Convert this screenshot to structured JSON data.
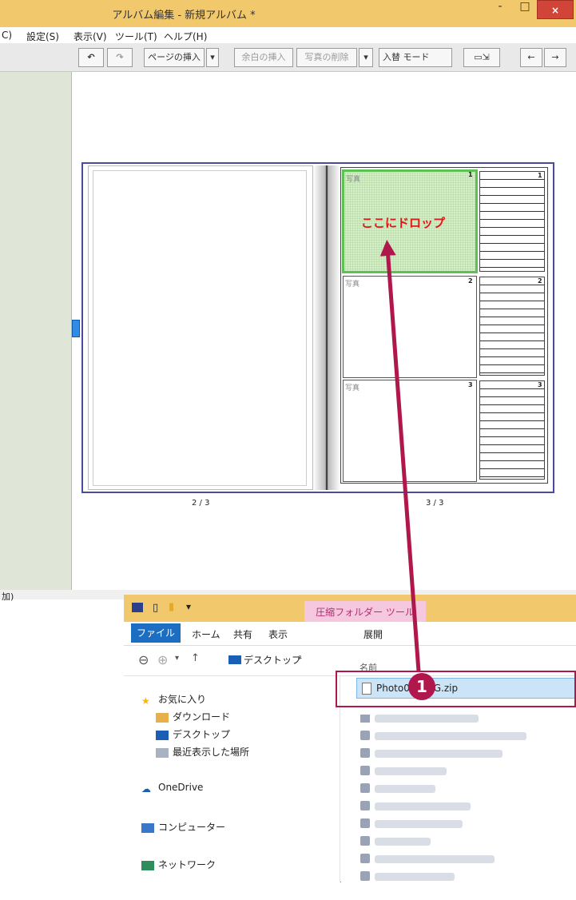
{
  "window": {
    "title": "アルバム編集 - 新規アルバム *",
    "close_label": "×",
    "minimize_label": "-",
    "maximize_label": "□"
  },
  "menu": [
    "C)",
    "設定(S)",
    "表示(V)",
    "ツール(T)",
    "ヘルプ(H)"
  ],
  "toolbar": {
    "insert_page": "ページの挿入",
    "insert_margin": "余白の挿入",
    "delete_photo": "写真の削除",
    "replace_mode": "入替 モード",
    "left_arrow": "←",
    "right_arrow": "→"
  },
  "page": {
    "left_number": "2 / 3",
    "right_number": "3 / 3",
    "cells": [
      {
        "label": "写真",
        "num": "1"
      },
      {
        "label": "写真",
        "num": "2"
      },
      {
        "label": "写真",
        "num": "3"
      }
    ],
    "drop_hint": "ここにドロップ"
  },
  "status": {
    "left": "加)"
  },
  "explorer": {
    "context_tool": "圧縮フォルダー ツール",
    "tabs": {
      "file": "ファイル",
      "home": "ホーム",
      "share": "共有",
      "view": "表示",
      "extract": "展開"
    },
    "address": "デスクトップ",
    "column_name": "名前",
    "nav": [
      "お気に入り",
      "ダウンロード",
      "デスクトップ",
      "最近表示した場所",
      "OneDrive",
      "コンピューター",
      "ネットワーク"
    ],
    "selected_file": "Photo001.JPG.zip",
    "badge": "1"
  }
}
